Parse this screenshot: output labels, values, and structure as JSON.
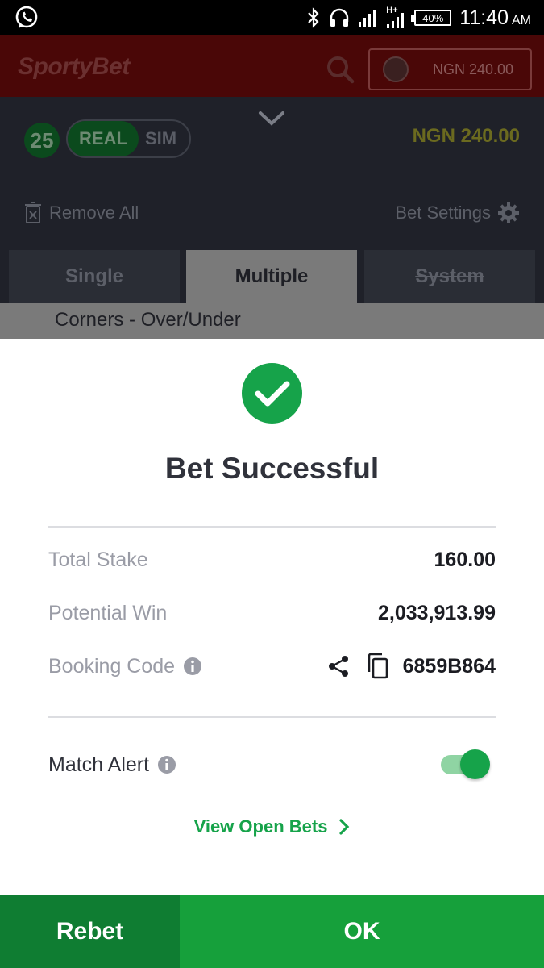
{
  "status_bar": {
    "battery": "40%",
    "time": "11:40",
    "ampm": "AM",
    "network": "H+",
    "icons": [
      "whatsapp-icon",
      "bluetooth-icon",
      "headphones-icon",
      "signal-icon",
      "battery-icon"
    ]
  },
  "header": {
    "logo": "SportyBet",
    "balance": "NGN 240.00"
  },
  "betslip": {
    "selection_count": "25",
    "mode_real": "REAL",
    "mode_sim": "SIM",
    "balance": "NGN 240.00",
    "remove_all": "Remove All",
    "bet_settings": "Bet Settings",
    "tabs": [
      "Single",
      "Multiple",
      "System"
    ],
    "active_tab": "Multiple",
    "market_label": "Corners - Over/Under"
  },
  "dialog": {
    "title": "Bet Successful",
    "total_stake_label": "Total Stake",
    "total_stake_value": "160.00",
    "potential_win_label": "Potential Win",
    "potential_win_value": "2,033,913.99",
    "booking_code_label": "Booking Code",
    "booking_code_value": "6859B864",
    "match_alert_label": "Match Alert",
    "match_alert_on": true,
    "view_open_bets": "View Open Bets"
  },
  "footer": {
    "rebet": "Rebet",
    "ok": "OK"
  },
  "colors": {
    "brand_green": "#16a34a",
    "dark_green": "#0f7d32",
    "overlay_bg": "#1f2129"
  }
}
